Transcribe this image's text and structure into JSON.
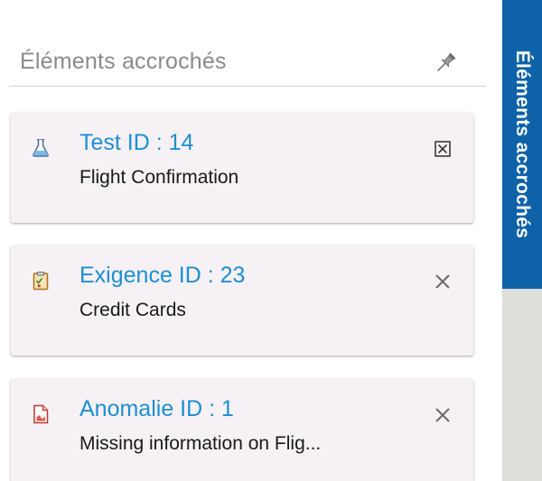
{
  "panel": {
    "title": "Éléments accrochés",
    "pin_icon": "pin-icon"
  },
  "cards": [
    {
      "title": "Test ID : 14",
      "subtitle": "Flight Confirmation",
      "icon": "flask-icon",
      "close_icon": "close-boxed-icon"
    },
    {
      "title": "Exigence ID : 23",
      "subtitle": "Credit Cards",
      "icon": "clipboard-icon",
      "close_icon": "close-icon"
    },
    {
      "title": "Anomalie ID : 1",
      "subtitle": "Missing information on Flig...",
      "icon": "defect-document-icon",
      "close_icon": "close-icon"
    }
  ],
  "rail": {
    "label": "Éléments accrochés"
  },
  "colors": {
    "link": "#1d8fd4",
    "rail_active": "#0e62a8",
    "rail_bg": "#dedfdb",
    "card_bg": "#f6f1f4"
  }
}
